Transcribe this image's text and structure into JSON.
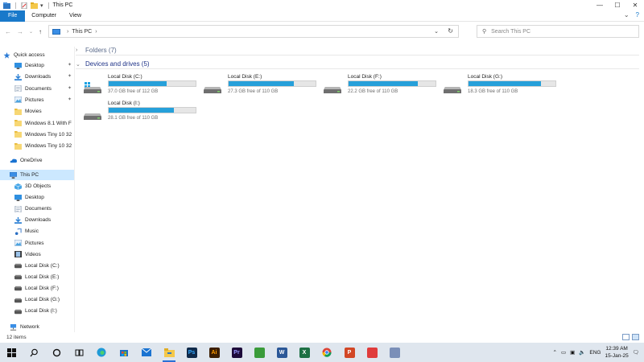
{
  "window": {
    "title": "This PC"
  },
  "ribbon": {
    "tabs": [
      "File",
      "Computer",
      "View"
    ]
  },
  "address": {
    "crumb": "This PC",
    "search_placeholder": "Search This PC"
  },
  "nav": {
    "quick_access": "Quick access",
    "quick_items": [
      {
        "label": "Desktop",
        "icon": "desktop-icon",
        "pinned": true
      },
      {
        "label": "Downloads",
        "icon": "downloads-icon",
        "pinned": true
      },
      {
        "label": "Documents",
        "icon": "documents-icon",
        "pinned": true
      },
      {
        "label": "Pictures",
        "icon": "pictures-icon",
        "pinned": true
      },
      {
        "label": "Movies",
        "icon": "folder-icon",
        "pinned": false
      },
      {
        "label": "Windows 8.1 With F",
        "icon": "folder-icon",
        "pinned": false
      },
      {
        "label": "Windows Tiny 10 32",
        "icon": "folder-icon",
        "pinned": false
      },
      {
        "label": "Windows Tiny 10 32",
        "icon": "folder-icon",
        "pinned": false
      }
    ],
    "onedrive": "OneDrive",
    "this_pc": "This PC",
    "pc_items": [
      {
        "label": "3D Objects",
        "icon": "3d-objects-icon"
      },
      {
        "label": "Desktop",
        "icon": "desktop-icon"
      },
      {
        "label": "Documents",
        "icon": "documents-icon"
      },
      {
        "label": "Downloads",
        "icon": "downloads-icon"
      },
      {
        "label": "Music",
        "icon": "music-icon"
      },
      {
        "label": "Pictures",
        "icon": "pictures-icon"
      },
      {
        "label": "Videos",
        "icon": "videos-icon"
      },
      {
        "label": "Local Disk (C:)",
        "icon": "drive-icon"
      },
      {
        "label": "Local Disk (E:)",
        "icon": "drive-icon"
      },
      {
        "label": "Local Disk (F:)",
        "icon": "drive-icon"
      },
      {
        "label": "Local Disk (G:)",
        "icon": "drive-icon"
      },
      {
        "label": "Local Disk (I:)",
        "icon": "drive-icon"
      }
    ],
    "network": "Network"
  },
  "content": {
    "folders_header": "Folders (7)",
    "drives_header": "Devices and drives (5)",
    "drives": [
      {
        "name": "Local Disk (C:)",
        "free": "37.0 GB free of 112 GB",
        "used_fraction": 0.67,
        "system": true
      },
      {
        "name": "Local Disk (E:)",
        "free": "27.3 GB free of 110 GB",
        "used_fraction": 0.75,
        "system": false
      },
      {
        "name": "Local Disk (F:)",
        "free": "22.2 GB free of 110 GB",
        "used_fraction": 0.8,
        "system": false
      },
      {
        "name": "Local Disk (G:)",
        "free": "18.3 GB free of 110 GB",
        "used_fraction": 0.83,
        "system": false
      },
      {
        "name": "Local Disk (I:)",
        "free": "28.1 GB free of 110 GB",
        "used_fraction": 0.75,
        "system": false
      }
    ]
  },
  "status": {
    "items": "12 items"
  },
  "taskbar": {
    "apps": [
      {
        "name": "start-icon"
      },
      {
        "name": "search-icon"
      },
      {
        "name": "cortana-icon"
      },
      {
        "name": "task-view-icon"
      },
      {
        "name": "edge-icon"
      },
      {
        "name": "store-icon"
      },
      {
        "name": "mail-icon"
      },
      {
        "name": "file-explorer-icon",
        "active": true
      },
      {
        "name": "photoshop-icon",
        "label": "Ps"
      },
      {
        "name": "illustrator-icon",
        "label": "Ai"
      },
      {
        "name": "premiere-icon",
        "label": "Pr"
      },
      {
        "name": "app-icon"
      },
      {
        "name": "word-icon",
        "label": "W"
      },
      {
        "name": "excel-icon",
        "label": "X"
      },
      {
        "name": "chrome-icon"
      },
      {
        "name": "powerpoint-icon",
        "label": "P"
      },
      {
        "name": "app-red-icon"
      },
      {
        "name": "app-blue-icon"
      }
    ],
    "lang": "ENG",
    "time": "12:39 AM",
    "date": "15-Jan-25"
  },
  "colors": {
    "accent": "#1979ca",
    "bar_fill": "#26a0da",
    "selected": "#cce8ff"
  }
}
